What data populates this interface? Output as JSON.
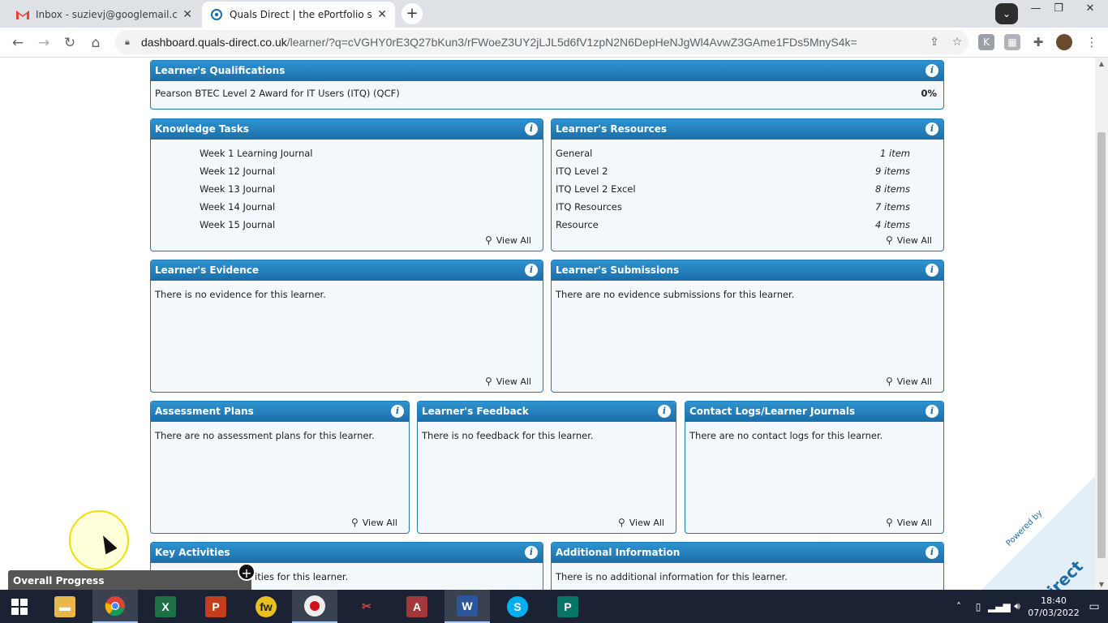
{
  "browser": {
    "tabs": [
      {
        "title": "Inbox - suzievj@googlemail.com",
        "icon": "gmail-icon"
      },
      {
        "title": "Quals Direct | the ePortfolio solut",
        "icon": "quals-direct-icon"
      }
    ],
    "url_host": "dashboard.quals-direct.co.uk",
    "url_path": "/learner/?q=cVGHY0rE3Q27bKun3/rFWoeZ3UY2jLJL5d6fV1zpN2N6DepHeNJgWl4AvwZ3GAme1FDs5MnyS4k="
  },
  "page": {
    "view_all": "View All",
    "qualifications": {
      "title": "Learner's Qualifications",
      "name": "Pearson BTEC Level 2 Award for IT Users (ITQ) (QCF)",
      "progress": "0%"
    },
    "knowledge_tasks": {
      "title": "Knowledge Tasks",
      "items": [
        "Week 1 Learning Journal",
        "Week 12 Journal",
        "Week 13 Journal",
        "Week 14 Journal",
        "Week 15 Journal"
      ]
    },
    "resources": {
      "title": "Learner's Resources",
      "items": [
        {
          "name": "General",
          "count": "1 item"
        },
        {
          "name": "ITQ Level 2",
          "count": "9 items"
        },
        {
          "name": "ITQ Level 2 Excel",
          "count": "8 items"
        },
        {
          "name": "ITQ Resources",
          "count": "7 items"
        },
        {
          "name": "Resource",
          "count": "4 items"
        }
      ]
    },
    "evidence": {
      "title": "Learner's Evidence",
      "text": "There is no evidence for this learner."
    },
    "submissions": {
      "title": "Learner's Submissions",
      "text": "There are no evidence submissions for this learner."
    },
    "assessment_plans": {
      "title": "Assessment Plans",
      "text": "There are no assessment plans for this learner."
    },
    "feedback": {
      "title": "Learner's Feedback",
      "text": "There is no feedback for this learner."
    },
    "contact_logs": {
      "title": "Contact Logs/Learner Journals",
      "text": "There are no contact logs for this learner."
    },
    "key_activities": {
      "title": "Key Activities",
      "text": "ities for this learner."
    },
    "additional_info": {
      "title": "Additional Information",
      "text": "There is no additional information for this learner."
    },
    "overall_progress": "Overall Progress",
    "watermark": {
      "powered": "Powered by",
      "brand": "QualsDirect"
    }
  },
  "taskbar": {
    "apps": [
      "file-explorer",
      "chrome",
      "excel",
      "powerpoint",
      "fw-app",
      "screen-recorder",
      "snipping-tool",
      "access",
      "word",
      "skype",
      "publisher"
    ],
    "time": "18:40",
    "date": "07/03/2022"
  }
}
